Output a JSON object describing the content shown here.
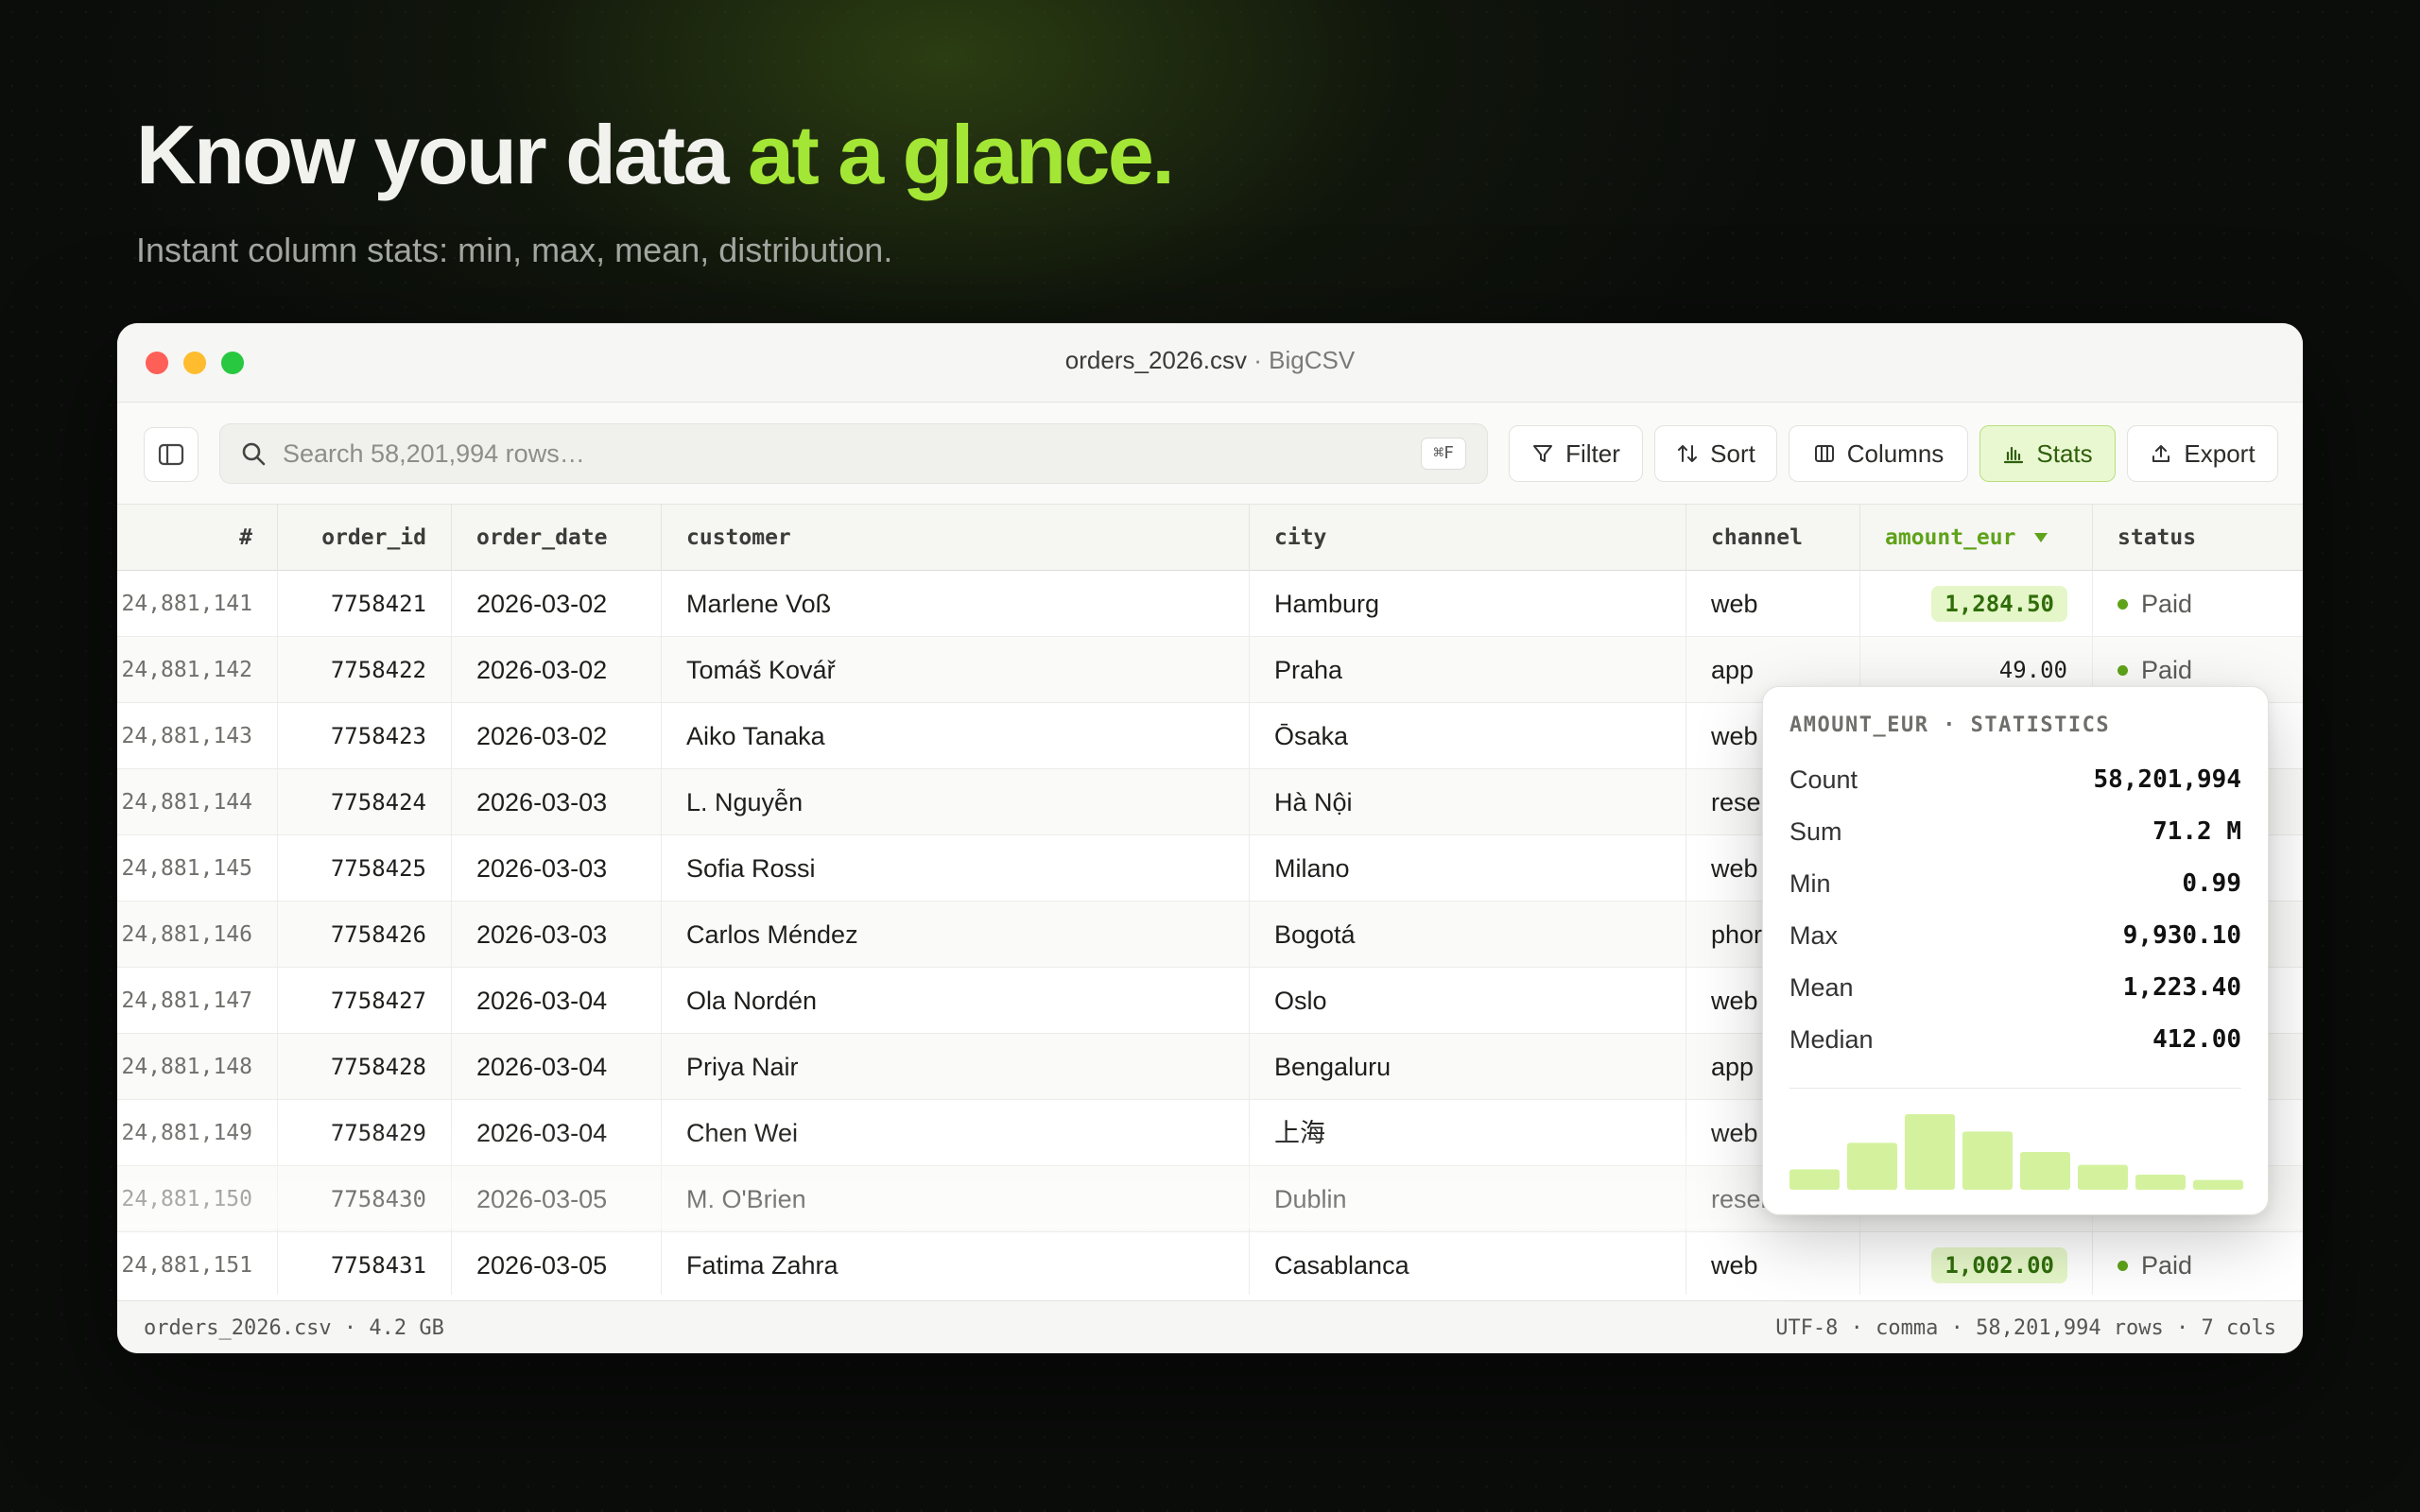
{
  "hero": {
    "title_main": "Know your data ",
    "title_accent": "at a glance.",
    "subtitle": "Instant column stats: min, max, mean, distribution."
  },
  "window": {
    "filename": "orders_2026.csv",
    "separator": " · ",
    "app_name": "BigCSV"
  },
  "toolbar": {
    "search_placeholder": "Search 58,201,994 rows…",
    "search_shortcut": "⌘F",
    "filter_label": "Filter",
    "sort_label": "Sort",
    "columns_label": "Columns",
    "stats_label": "Stats",
    "export_label": "Export"
  },
  "table": {
    "columns": [
      "#",
      "order_id",
      "order_date",
      "customer",
      "city",
      "channel",
      "amount_eur",
      "status"
    ],
    "sorted_column": "amount_eur",
    "rows": [
      {
        "n": "24,881,141",
        "order_id": "7758421",
        "date": "2026-03-02",
        "customer": "Marlene Voß",
        "city": "Hamburg",
        "channel": "web",
        "amount": "1,284.50",
        "status": "Paid"
      },
      {
        "n": "24,881,142",
        "order_id": "7758422",
        "date": "2026-03-02",
        "customer": "Tomáš Kovář",
        "city": "Praha",
        "channel": "app",
        "amount": "49.00",
        "status": "Paid"
      },
      {
        "n": "24,881,143",
        "order_id": "7758423",
        "date": "2026-03-02",
        "customer": "Aiko Tanaka",
        "city": "Ōsaka",
        "channel": "web",
        "amount": "",
        "status": ""
      },
      {
        "n": "24,881,144",
        "order_id": "7758424",
        "date": "2026-03-03",
        "customer": "L. Nguyễn",
        "city": "Hà Nội",
        "channel": "resel",
        "amount": "",
        "status": ""
      },
      {
        "n": "24,881,145",
        "order_id": "7758425",
        "date": "2026-03-03",
        "customer": "Sofia Rossi",
        "city": "Milano",
        "channel": "web",
        "amount": "",
        "status": ""
      },
      {
        "n": "24,881,146",
        "order_id": "7758426",
        "date": "2026-03-03",
        "customer": "Carlos Méndez",
        "city": "Bogotá",
        "channel": "phor",
        "amount": "",
        "status": ""
      },
      {
        "n": "24,881,147",
        "order_id": "7758427",
        "date": "2026-03-04",
        "customer": "Ola Nordén",
        "city": "Oslo",
        "channel": "web",
        "amount": "",
        "status": ""
      },
      {
        "n": "24,881,148",
        "order_id": "7758428",
        "date": "2026-03-04",
        "customer": "Priya Nair",
        "city": "Bengaluru",
        "channel": "app",
        "amount": "",
        "status": ""
      },
      {
        "n": "24,881,149",
        "order_id": "7758429",
        "date": "2026-03-04",
        "customer": "Chen Wei",
        "city": "上海",
        "channel": "web",
        "amount": "",
        "status": ""
      },
      {
        "n": "24,881,150",
        "order_id": "7758430",
        "date": "2026-03-05",
        "customer": "M. O'Brien",
        "city": "Dublin",
        "channel": "resel",
        "amount": "",
        "status": ""
      },
      {
        "n": "24,881,151",
        "order_id": "7758431",
        "date": "2026-03-05",
        "customer": "Fatima Zahra",
        "city": "Casablanca",
        "channel": "web",
        "amount": "1,002.00",
        "status": "Paid"
      }
    ]
  },
  "stats": {
    "title": "AMOUNT_EUR · STATISTICS",
    "items": [
      {
        "label": "Count",
        "value": "58,201,994"
      },
      {
        "label": "Sum",
        "value": "71.2 M"
      },
      {
        "label": "Min",
        "value": "0.99"
      },
      {
        "label": "Max",
        "value": "9,930.10"
      },
      {
        "label": "Mean",
        "value": "1,223.40"
      },
      {
        "label": "Median",
        "value": "412.00"
      }
    ],
    "histogram": [
      0.27,
      0.62,
      1.0,
      0.77,
      0.5,
      0.33,
      0.2,
      0.13
    ],
    "histogram_color": "#d4f29e"
  },
  "statusbar": {
    "left": "orders_2026.csv · 4.2 GB",
    "right": "UTF-8 · comma · 58,201,994 rows · 7 cols"
  },
  "colors": {
    "accent": "#a3e635",
    "accent_dark": "#5fa31a",
    "pill_bg": "#e5f6c8"
  }
}
